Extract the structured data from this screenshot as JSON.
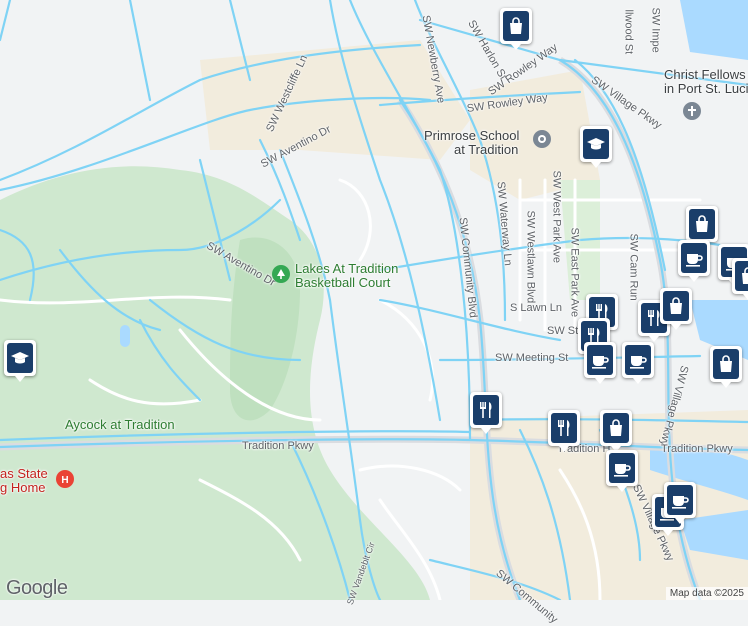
{
  "colors": {
    "background": "#f1f3f4",
    "green": "#cfe8cf",
    "sand": "#f2ecdd",
    "water": "#aadaff",
    "route": "#7fd3f5",
    "marker": "#1a3e6a"
  },
  "streets": {
    "newberry_ave": "SW Newberry Ave",
    "harlon_st": "SW Harlon St",
    "rowley_way": "SW Rowley Way",
    "rowley_way_2": "SW Rowley Way",
    "westcliffe_ln": "SW Westcliffe Ln",
    "aventino_dr_north": "SW Aventino Dr",
    "aventino_dr_west": "SW Aventino Dr",
    "village_pkwy_north": "SW Village Pkwy",
    "village_pkwy_mid": "SW Village Pkwy",
    "village_pkwy_south": "SW Village Pkwy",
    "community_blvd": "SW Community Blvd",
    "community_blvd_south": "SW Community",
    "waterway_ln": "SW Waterway Ln",
    "westlawn_blvd": "SW Westlawn Blvd",
    "west_park_ave": "SW West Park Ave",
    "east_park_ave": "SW East Park Ave",
    "cam_run": "SW Cam Run",
    "lawn_ln": "S Lawn Ln",
    "sw_st": "SW St",
    "meeting_st": "SW Meeting St",
    "tradition_pkwy_west": "Tradition Pkwy",
    "tradition_pkwy_east": "Tradition Pkwy",
    "tradition_h": "Tradition H",
    "vandeblt_cir": "SW Vandeblt Cir",
    "llwood_st": "llwood St",
    "imperial_st": "SW Impe"
  },
  "places": {
    "primrose_line1": "Primrose School",
    "primrose_line2": "at Tradition",
    "christ_line1": "Christ Fellows",
    "christ_line2": "in Port St. Luci",
    "lakes_line1": "Lakes At Tradition",
    "lakes_line2": "Basketball Court",
    "aycock": "Aycock at Tradition",
    "texas_line1": "as State",
    "texas_line2": "g Home"
  },
  "markers": [
    {
      "icon": "shopping-bag"
    },
    {
      "icon": "school"
    },
    {
      "icon": "school"
    },
    {
      "icon": "shopping-bag"
    },
    {
      "icon": "coffee"
    },
    {
      "icon": "coffee"
    },
    {
      "icon": "shopping-bag"
    },
    {
      "icon": "restaurant"
    },
    {
      "icon": "restaurant"
    },
    {
      "icon": "restaurant"
    },
    {
      "icon": "shopping-bag"
    },
    {
      "icon": "coffee"
    },
    {
      "icon": "coffee"
    },
    {
      "icon": "shopping-bag"
    },
    {
      "icon": "restaurant"
    },
    {
      "icon": "restaurant"
    },
    {
      "icon": "shopping-bag"
    },
    {
      "icon": "coffee"
    },
    {
      "icon": "coffee"
    },
    {
      "icon": "coffee"
    }
  ],
  "branding": {
    "logo": "Google",
    "attribution": "Map data ©2025"
  }
}
